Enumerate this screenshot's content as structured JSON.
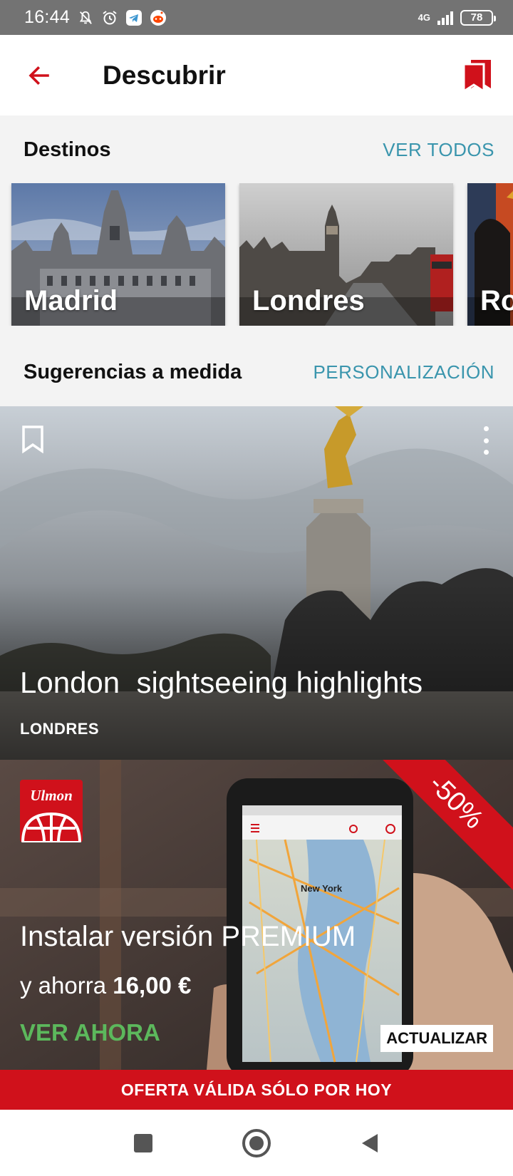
{
  "status_bar": {
    "time": "16:44",
    "network": "4G",
    "battery": "78"
  },
  "app_bar": {
    "title": "Descubrir",
    "accent_color": "#d0111b"
  },
  "destinations": {
    "title": "Destinos",
    "link": "VER TODOS",
    "items": [
      {
        "name": "Madrid"
      },
      {
        "name": "Londres"
      },
      {
        "name": "Ro"
      }
    ]
  },
  "suggestions": {
    "title": "Sugerencias a medida",
    "link": "PERSONALIZACIÓN",
    "card": {
      "title": "London  sightseeing highlights",
      "city": "LONDRES"
    }
  },
  "promo": {
    "logo_text": "Ulmon",
    "discount": "-50%",
    "title": "Instalar versión PREMIUM",
    "save_prefix": "y ahorra",
    "save_amount": "16,00 €",
    "cta": "VER AHORA",
    "update": "ACTUALIZAR",
    "map_label": "New York"
  },
  "offer_bar": {
    "text": "OFERTA VÁLIDA SÓLO POR HOY"
  },
  "link_color": "#3a95ad",
  "cta_color": "#5cb85c"
}
